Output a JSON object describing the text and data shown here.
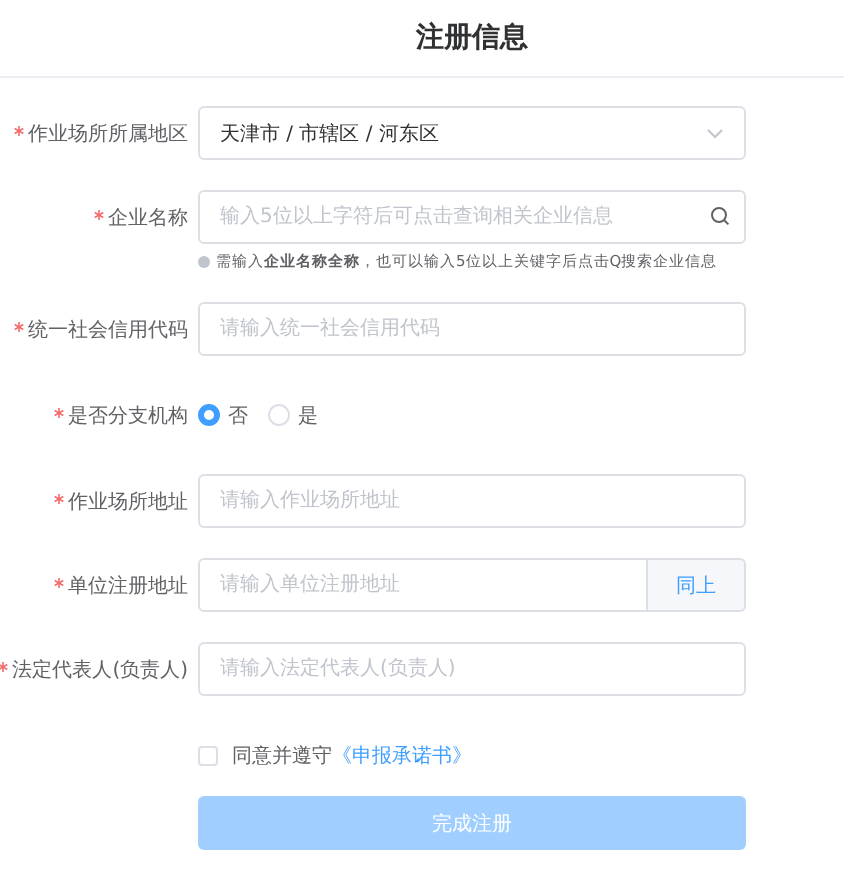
{
  "title": "注册信息",
  "fields": [
    {
      "kind": "select",
      "label": "作业场所所属地区",
      "required": true,
      "value": "天津市 / 市辖区 / 河东区"
    },
    {
      "kind": "search",
      "label": "企业名称",
      "required": true,
      "placeholder": "输入5位以上字符后可点击查询相关企业信息",
      "hint": "需输入**企业名称全称**，也可以输入5位以上关键字后点击Q搜索企业信息"
    },
    {
      "kind": "text",
      "label": "统一社会信用代码",
      "required": true,
      "placeholder": "请输入统一社会信用代码"
    },
    {
      "kind": "radio",
      "label": "是否分支机构",
      "required": true,
      "options": [
        {
          "label": "否",
          "selected": true
        },
        {
          "label": "是",
          "selected": false
        }
      ]
    },
    {
      "kind": "text",
      "label": "作业场所地址",
      "required": true,
      "placeholder": "请输入作业场所地址"
    },
    {
      "kind": "button",
      "label": "单位注册地址",
      "required": true,
      "placeholder": "请输入单位注册地址",
      "button": "同上"
    },
    {
      "kind": "text",
      "label": "法定代表人(负责人)",
      "required": true,
      "placeholder": "请输入法定代表人(负责人)"
    }
  ],
  "agreement": {
    "checked": false,
    "text": "同意并遵守",
    "link": "《申报承诺书》"
  },
  "submit": {
    "label": "完成注册",
    "disabled": true
  }
}
